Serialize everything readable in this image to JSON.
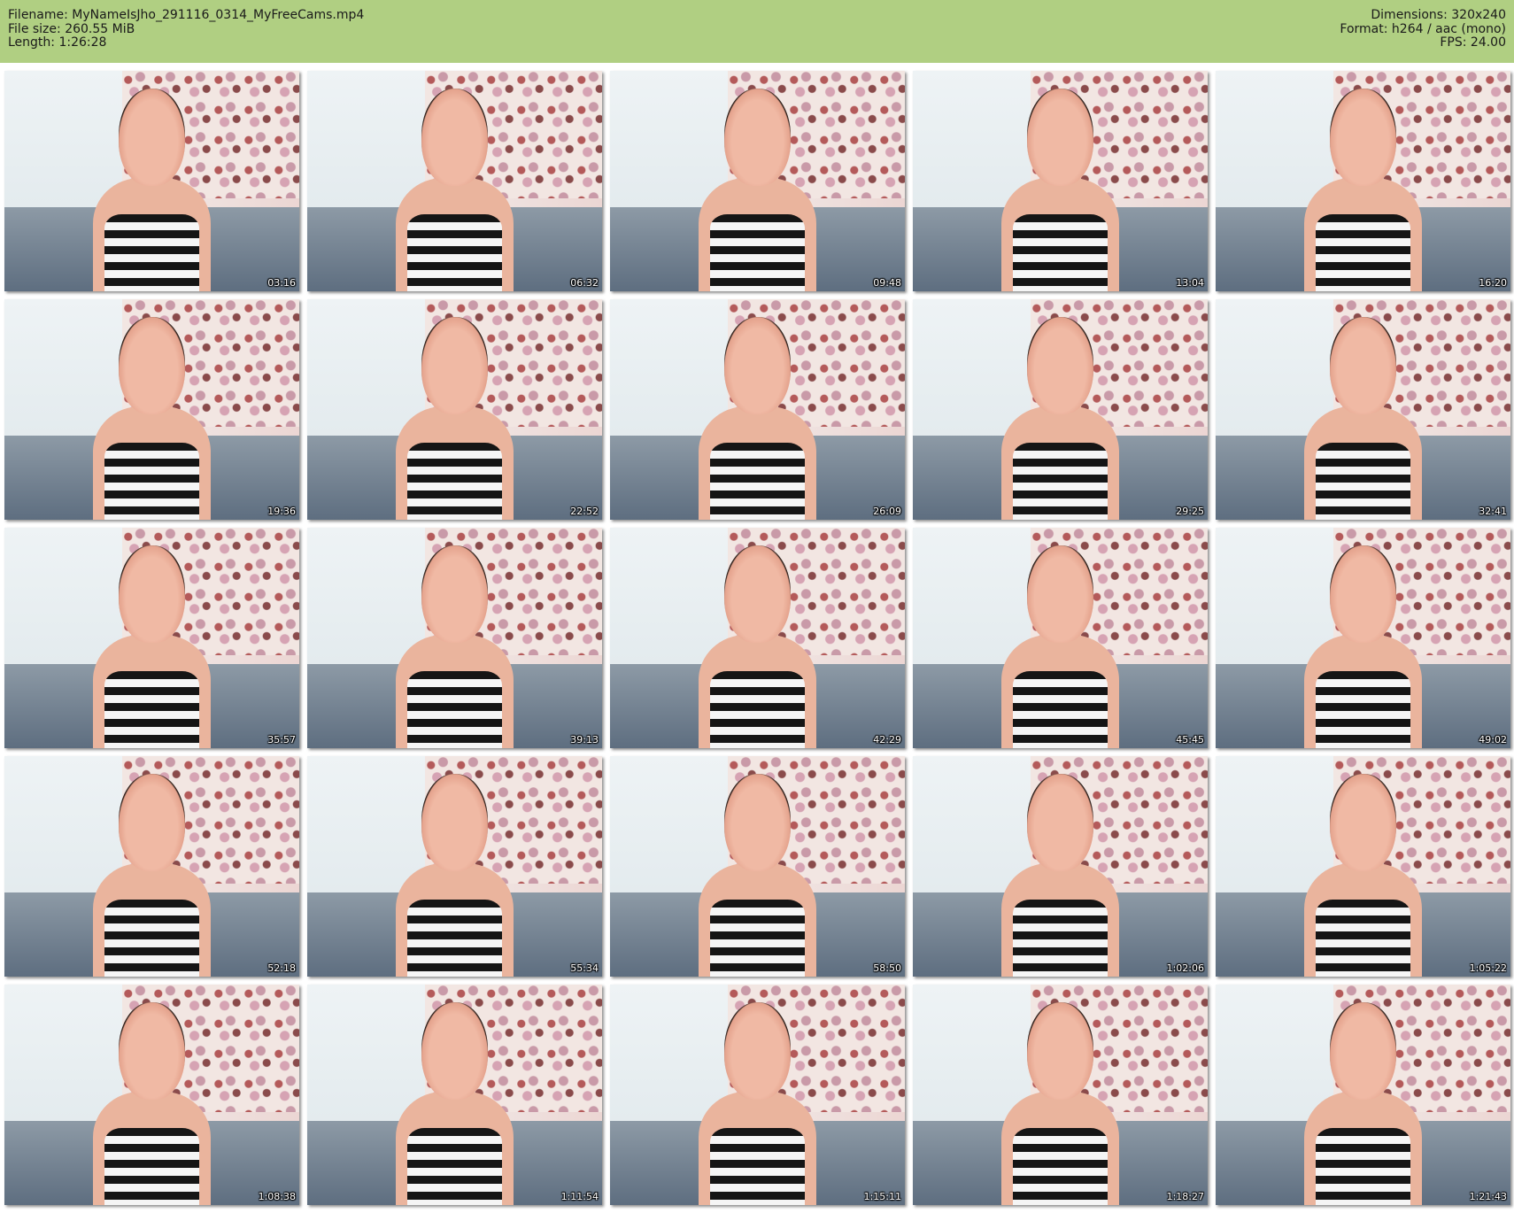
{
  "header": {
    "filename": "Filename: MyNameIsJho_291116_0314_MyFreeCams.mp4",
    "filesize": "File size: 260.55 MiB",
    "length": "Length: 1:26:28",
    "dimensions": "Dimensions: 320x240",
    "format": "Format: h264 / aac (mono)",
    "fps": "FPS: 24.00"
  },
  "thumbnails": [
    {
      "timestamp": "03:16"
    },
    {
      "timestamp": "06:32"
    },
    {
      "timestamp": "09:48"
    },
    {
      "timestamp": "13:04"
    },
    {
      "timestamp": "16:20"
    },
    {
      "timestamp": "19:36"
    },
    {
      "timestamp": "22:52"
    },
    {
      "timestamp": "26:09"
    },
    {
      "timestamp": "29:25"
    },
    {
      "timestamp": "32:41"
    },
    {
      "timestamp": "35:57"
    },
    {
      "timestamp": "39:13"
    },
    {
      "timestamp": "42:29"
    },
    {
      "timestamp": "45:45"
    },
    {
      "timestamp": "49:02"
    },
    {
      "timestamp": "52:18"
    },
    {
      "timestamp": "55:34"
    },
    {
      "timestamp": "58:50"
    },
    {
      "timestamp": "1:02:06"
    },
    {
      "timestamp": "1:05:22"
    },
    {
      "timestamp": "1:08:38"
    },
    {
      "timestamp": "1:11:54"
    },
    {
      "timestamp": "1:15:11"
    },
    {
      "timestamp": "1:18:27"
    },
    {
      "timestamp": "1:21:43"
    }
  ]
}
